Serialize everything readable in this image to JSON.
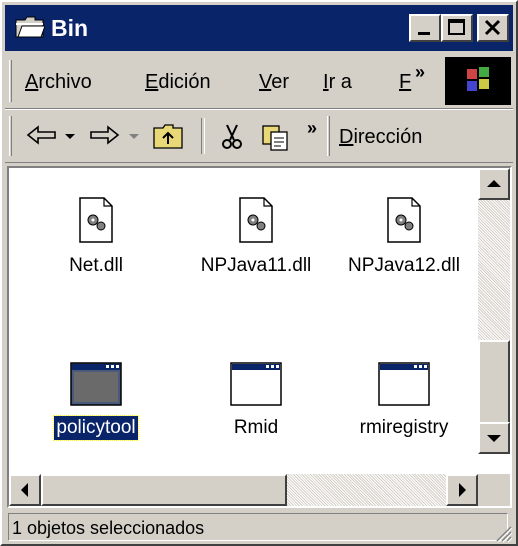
{
  "window": {
    "title": "Bin"
  },
  "menu": {
    "items": [
      "Archivo",
      "Edición",
      "Ver",
      "Ir a"
    ],
    "accelerators": [
      "A",
      "E",
      "V",
      "I"
    ],
    "rests": [
      "rchivo",
      "dición",
      "er",
      "r a"
    ],
    "overflow_label": "F",
    "overflow_chevron": "»"
  },
  "toolbar": {
    "chevron": "»",
    "address_accel": "D",
    "address_rest": "irección"
  },
  "files": [
    {
      "name": "Net.dll",
      "icon": "dll-icon",
      "selected": false
    },
    {
      "name": "NPJava11.dll",
      "icon": "dll-icon",
      "selected": false
    },
    {
      "name": "NPJava12.dll",
      "icon": "dll-icon",
      "selected": false
    },
    {
      "name": "policytool",
      "icon": "application-window-icon",
      "selected": true
    },
    {
      "name": "Rmid",
      "icon": "application-window-icon",
      "selected": false
    },
    {
      "name": "rmiregistry",
      "icon": "application-window-icon",
      "selected": false
    }
  ],
  "status": {
    "text": "1 objetos seleccionados"
  },
  "colors": {
    "titlebar": "#0a246a",
    "face": "#d4d0c8",
    "selection": "#0a246a"
  }
}
